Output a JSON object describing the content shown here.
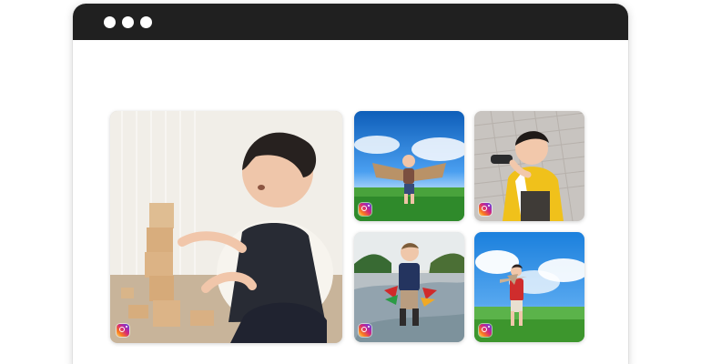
{
  "window": {
    "controls": [
      "window-dot",
      "window-dot",
      "window-dot"
    ]
  },
  "gallery": {
    "tiles": [
      {
        "name": "child-with-wooden-blocks",
        "icon": "instagram-icon"
      },
      {
        "name": "child-with-cardboard-wings",
        "icon": "instagram-icon"
      },
      {
        "name": "child-with-binoculars",
        "icon": "instagram-icon"
      },
      {
        "name": "child-with-toy-planes-in-puddle",
        "icon": "instagram-icon"
      },
      {
        "name": "child-with-toy-airplane-in-field",
        "icon": "instagram-icon"
      }
    ]
  },
  "colors": {
    "titlebar": "#202020",
    "window_background": "#ffffff",
    "sky": "#3f8ee3",
    "grass": "#3f9a34",
    "jacket": "#f2c318",
    "shirt": "#cf2f2f"
  }
}
